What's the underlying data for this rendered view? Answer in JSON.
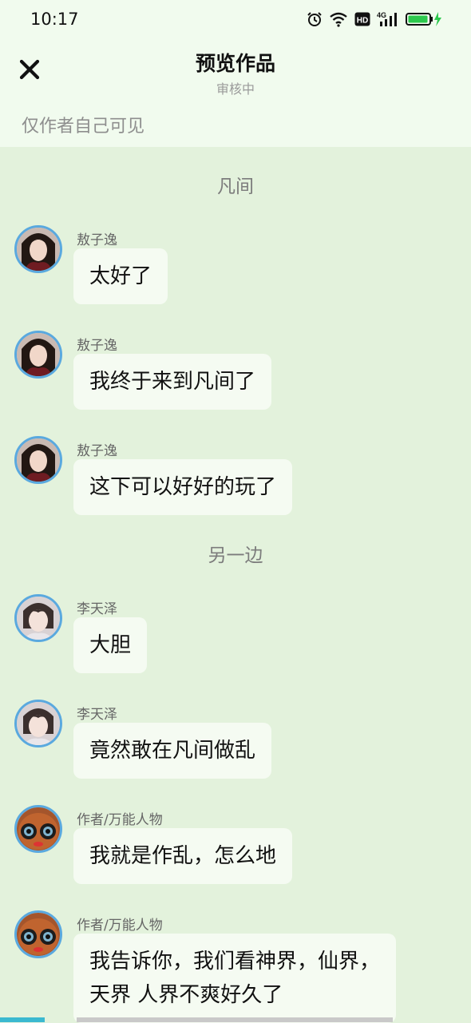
{
  "status": {
    "time": "10:17",
    "icons": [
      "alarm-icon",
      "wifi-icon",
      "hd-icon",
      "signal-4g-icon",
      "battery-charging-icon"
    ],
    "network": "4G",
    "hd": "HD"
  },
  "header": {
    "title": "预览作品",
    "subtitle": "审核中",
    "visibility": "仅作者自己可见",
    "close_icon": "close-icon"
  },
  "colors": {
    "background": "#e3f2dc",
    "header_bg": "#f1fbee",
    "bubble_bg": "#f5fbf2",
    "avatar_ring": "#5aa9df",
    "battery": "#2dc84d"
  },
  "chat": {
    "scene1": "凡间",
    "scene2": "另一边",
    "messages": [
      {
        "name": "敖子逸",
        "text": "太好了"
      },
      {
        "name": "敖子逸",
        "text": "我终于来到凡间了"
      },
      {
        "name": "敖子逸",
        "text": "这下可以好好的玩了"
      },
      {
        "name": "李天泽",
        "text": "大胆"
      },
      {
        "name": "李天泽",
        "text": "竟然敢在凡间做乱"
      },
      {
        "name": "作者/万能人物",
        "text": "我就是作乱，怎么地"
      },
      {
        "name": "作者/万能人物",
        "text": "我告诉你，我们看神界，仙界，天界 人界不爽好久了"
      }
    ]
  }
}
